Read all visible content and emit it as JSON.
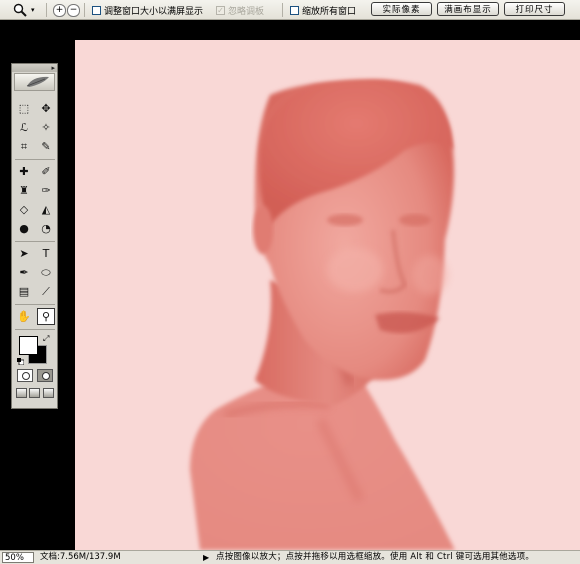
{
  "options_bar": {
    "zoom_tool_icon": "zoom-tool-icon",
    "zoom_in_icon": "zoom-in-icon",
    "zoom_out_icon": "zoom-out-icon",
    "resize_windows_label": "调整窗口大小以满屏显示",
    "ignore_palettes_label": "忽略调板",
    "zoom_all_windows_label": "缩放所有窗口",
    "actual_pixels_label": "实际像素",
    "fit_screen_label": "满画布显示",
    "print_size_label": "打印尺寸"
  },
  "toolbox": {
    "rows": [
      [
        {
          "name": "marquee-tool-icon",
          "glyph": "⬚"
        },
        {
          "name": "move-tool-icon",
          "glyph": "✥"
        }
      ],
      [
        {
          "name": "lasso-tool-icon",
          "glyph": "ℒ"
        },
        {
          "name": "magic-wand-tool-icon",
          "glyph": "✧"
        }
      ],
      [
        {
          "name": "crop-tool-icon",
          "glyph": "⌗"
        },
        {
          "name": "slice-tool-icon",
          "glyph": "✎"
        }
      ],
      [
        {
          "name": "healing-brush-tool-icon",
          "glyph": "✚"
        },
        {
          "name": "brush-tool-icon",
          "glyph": "✐"
        }
      ],
      [
        {
          "name": "clone-stamp-tool-icon",
          "glyph": "♜"
        },
        {
          "name": "history-brush-tool-icon",
          "glyph": "✑"
        }
      ],
      [
        {
          "name": "eraser-tool-icon",
          "glyph": "◇"
        },
        {
          "name": "paint-bucket-tool-icon",
          "glyph": "◭"
        }
      ],
      [
        {
          "name": "blur-tool-icon",
          "glyph": "●"
        },
        {
          "name": "dodge-tool-icon",
          "glyph": "◔"
        }
      ],
      [
        {
          "name": "path-selection-tool-icon",
          "glyph": "➤"
        },
        {
          "name": "type-tool-icon",
          "glyph": "T"
        }
      ],
      [
        {
          "name": "pen-tool-icon",
          "glyph": "✒"
        },
        {
          "name": "ellipse-tool-icon",
          "glyph": "⬭"
        }
      ],
      [
        {
          "name": "notes-tool-icon",
          "glyph": "▤"
        },
        {
          "name": "eyedropper-tool-icon",
          "glyph": "⟋"
        }
      ],
      [
        {
          "name": "hand-tool-icon",
          "glyph": "✋"
        },
        {
          "name": "zoom-tool-icon",
          "glyph": "⚲"
        }
      ]
    ],
    "active_tool": "zoom-tool-icon",
    "foreground_color": "#ffffff",
    "background_color": "#000000"
  },
  "canvas": {
    "background_color": "#f9d8d6",
    "figure_color": "#e07c72"
  },
  "status_bar": {
    "zoom_value": "50%",
    "doc_size": "文档:7.56M/137.9M",
    "arrow_icon": "▶",
    "hint": "点按图像以放大；点按并拖移以用选框缩放。使用 Alt 和 Ctrl 键可选用其他选项。"
  }
}
